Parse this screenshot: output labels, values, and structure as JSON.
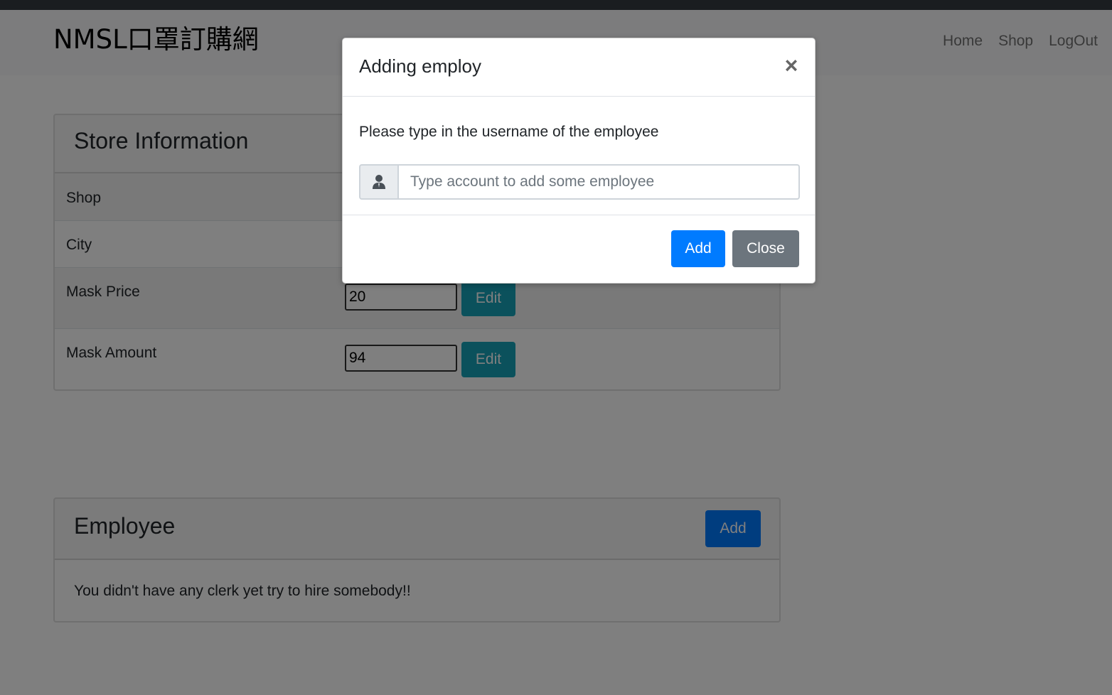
{
  "navbar": {
    "brand": "NMSL口罩訂購網",
    "links": [
      "Home",
      "Shop",
      "LogOut"
    ]
  },
  "store_card": {
    "title": "Store Information",
    "rows": [
      {
        "label": "Shop"
      },
      {
        "label": "City"
      },
      {
        "label": "Mask Price",
        "value": "20",
        "button": "Edit"
      },
      {
        "label": "Mask Amount",
        "value": "94",
        "button": "Edit"
      }
    ]
  },
  "employee_card": {
    "title": "Employee",
    "add_button": "Add",
    "empty_message": "You didn't have any clerk yet try to hire somebody!!"
  },
  "modal": {
    "title": "Adding employ",
    "close_symbol": "×",
    "prompt": "Please type in the username of the employee",
    "input_placeholder": "Type account to add some employee",
    "input_icon": "user-icon",
    "add_button": "Add",
    "close_button": "Close"
  },
  "colors": {
    "primary": "#007bff",
    "info": "#17a2b8",
    "secondary": "#6c757d",
    "backdrop": "rgba(0,0,0,0.5)"
  }
}
